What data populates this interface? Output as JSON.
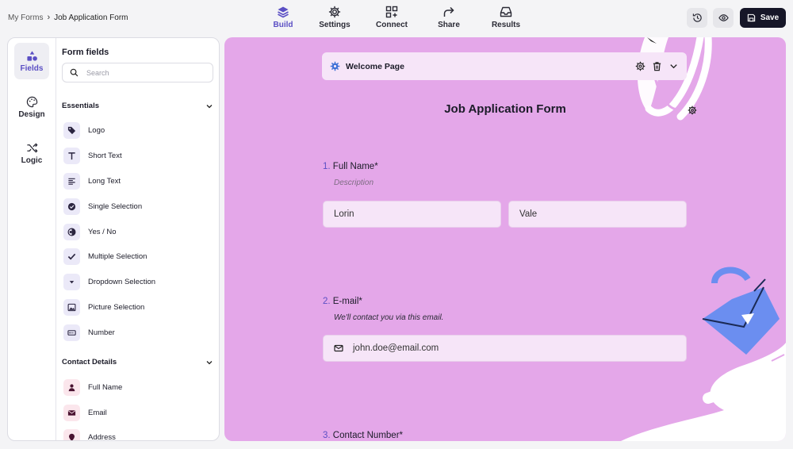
{
  "breadcrumb": {
    "root": "My Forms",
    "current": "Job Application Form"
  },
  "nav_tabs": [
    {
      "label": "Build",
      "icon": "layers-icon"
    },
    {
      "label": "Settings",
      "icon": "gear-icon"
    },
    {
      "label": "Connect",
      "icon": "grid-plus-icon"
    },
    {
      "label": "Share",
      "icon": "share-arrow-icon"
    },
    {
      "label": "Results",
      "icon": "inbox-icon"
    }
  ],
  "actions": {
    "save_label": "Save"
  },
  "sidebar_rail": [
    {
      "label": "Fields",
      "icon": "shapes-icon"
    },
    {
      "label": "Design",
      "icon": "palette-icon"
    },
    {
      "label": "Logic",
      "icon": "shuffle-icon"
    }
  ],
  "panel": {
    "title": "Form fields",
    "search_placeholder": "Search",
    "sections": [
      {
        "title": "Essentials",
        "items": [
          {
            "label": "Logo",
            "icon": "tag-icon"
          },
          {
            "label": "Short Text",
            "icon": "text-t-icon"
          },
          {
            "label": "Long Text",
            "icon": "paragraph-icon"
          },
          {
            "label": "Single Selection",
            "icon": "radio-check-icon"
          },
          {
            "label": "Yes / No",
            "icon": "half-circle-icon"
          },
          {
            "label": "Multiple Selection",
            "icon": "checkmark-icon"
          },
          {
            "label": "Dropdown Selection",
            "icon": "dropdown-icon"
          },
          {
            "label": "Picture Selection",
            "icon": "image-icon"
          },
          {
            "label": "Number",
            "icon": "number-icon"
          }
        ]
      },
      {
        "title": "Contact Details",
        "items": [
          {
            "label": "Full Name",
            "icon": "person-icon"
          },
          {
            "label": "Email",
            "icon": "envelope-icon"
          },
          {
            "label": "Address",
            "icon": "location-icon"
          }
        ]
      }
    ]
  },
  "form": {
    "welcome_label": "Welcome Page",
    "title": "Job Application Form",
    "questions": [
      {
        "number": "1.",
        "label": "Full Name*",
        "description": "Description",
        "values": [
          "Lorin",
          "Vale"
        ]
      },
      {
        "number": "2.",
        "label": "E-mail*",
        "description": "We'll contact you via this email.",
        "value": "john.doe@email.com"
      },
      {
        "number": "3.",
        "label": "Contact Number*"
      }
    ]
  },
  "colors": {
    "accent": "#5b4fc4",
    "canvas": "#e4a7e9",
    "save_bg": "#161628"
  }
}
